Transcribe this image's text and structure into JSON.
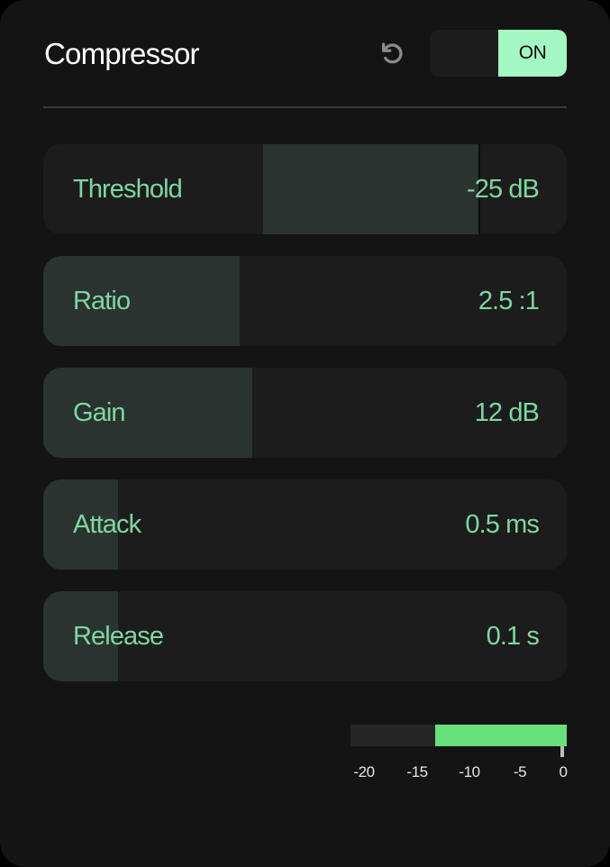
{
  "header": {
    "title": "Compressor",
    "reset_icon": "reset-icon",
    "power_toggle": {
      "state": "ON",
      "label": "ON",
      "on": true
    }
  },
  "colors": {
    "accent": "#a3f7c3",
    "label_text": "#7fd6a3",
    "slider_fill": "#2a332f",
    "meter_fill": "#68e07c",
    "meter_track": "#262626",
    "panel_bg": "#141414",
    "slider_bg": "#1c1c1c"
  },
  "controls": [
    {
      "id": "threshold",
      "label": "Threshold",
      "value": "-25 dB",
      "fill_start": 0.42,
      "fill_end": 0.833,
      "marker": true
    },
    {
      "id": "ratio",
      "label": "Ratio",
      "value": "2.5 :1",
      "fill_start": 0,
      "fill_end": 0.375,
      "marker": false
    },
    {
      "id": "gain",
      "label": "Gain",
      "value": "12 dB",
      "fill_start": 0,
      "fill_end": 0.4,
      "marker": false
    },
    {
      "id": "attack",
      "label": "Attack",
      "value": "0.5 ms",
      "fill_start": 0,
      "fill_end": 0.143,
      "marker": false
    },
    {
      "id": "release",
      "label": "Release",
      "value": "0.1 s",
      "fill_start": 0,
      "fill_end": 0.143,
      "marker": false
    }
  ],
  "meter": {
    "level_fraction": 0.61,
    "ticks": [
      "-20",
      "-15",
      "-10",
      "-5",
      "0"
    ]
  }
}
